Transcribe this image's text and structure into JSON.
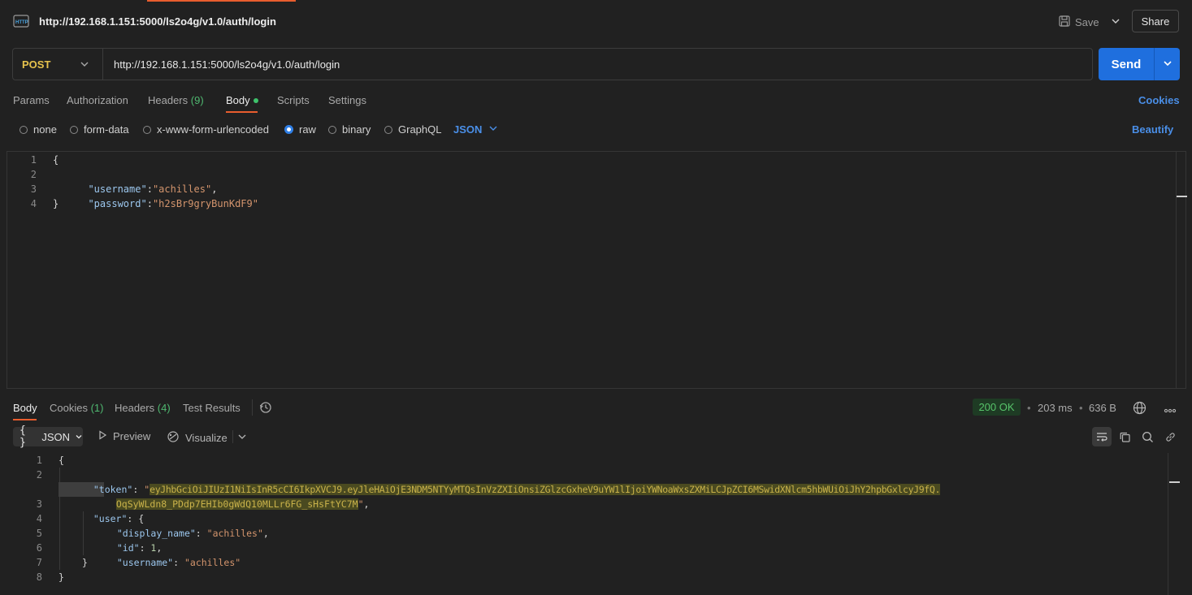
{
  "title_bar": {
    "request_url": "http://192.168.1.151:5000/ls2o4g/v1.0/auth/login",
    "save_label": "Save",
    "share_label": "Share"
  },
  "request": {
    "method": "POST",
    "url": "http://192.168.1.151:5000/ls2o4g/v1.0/auth/login",
    "send_label": "Send"
  },
  "request_tabs": {
    "params": "Params",
    "authorization": "Authorization",
    "headers": "Headers",
    "headers_count": "(9)",
    "body": "Body",
    "scripts": "Scripts",
    "settings": "Settings",
    "cookies_link": "Cookies"
  },
  "body_types": {
    "none": "none",
    "form_data": "form-data",
    "urlencoded": "x-www-form-urlencoded",
    "raw": "raw",
    "binary": "binary",
    "graphql": "GraphQL",
    "selected_format": "JSON",
    "beautify": "Beautify"
  },
  "request_body": {
    "line1": "{",
    "line2_key": "\"username\"",
    "line2_val": "\"achilles\"",
    "line3_key": "\"password\"",
    "line3_val": "\"h2sBr9gryBunKdF9\"",
    "line4": "}"
  },
  "response_tabs": {
    "body": "Body",
    "cookies": "Cookies",
    "cookies_count": "(1)",
    "headers": "Headers",
    "headers_count": "(4)",
    "test_results": "Test Results"
  },
  "response_meta": {
    "status": "200 OK",
    "time": "203 ms",
    "size": "636 B",
    "separator": "•"
  },
  "response_toolbar": {
    "format": "JSON",
    "preview": "Preview",
    "visualize": "Visualize"
  },
  "response_body": {
    "open_brace": "{",
    "token_key": "\"token\"",
    "token_line1": "eyJhbGciOiJIUzI1NiIsInR5cCI6IkpXVCJ9.eyJleHAiOjE3NDM5NTYyMTQsInVzZXIiOnsiZGlzcGxheV9uYW1lIjoiYWNoaWxsZXMiLCJpZCI6MSwidXNlcm5hbWUiOiJhY2hpbGxlcyJ9fQ.",
    "token_line2": "OqSyWLdn8_PDdp7EHIb0gWdQ10MLLr6FG_sHsFtYC7M",
    "user_key": "\"user\"",
    "display_name_key": "\"display_name\"",
    "display_name_val": "\"achilles\"",
    "id_key": "\"id\"",
    "id_val": "1",
    "username_key": "\"username\"",
    "username_val": "\"achilles\"",
    "close_inner": "}",
    "close_outer": "}"
  },
  "colors": {
    "accent": "#e85d2e",
    "send_blue": "#1f6fde",
    "link_blue": "#4a8fe8",
    "status_green": "#57c46a",
    "method_yellow": "#e6c24d"
  }
}
